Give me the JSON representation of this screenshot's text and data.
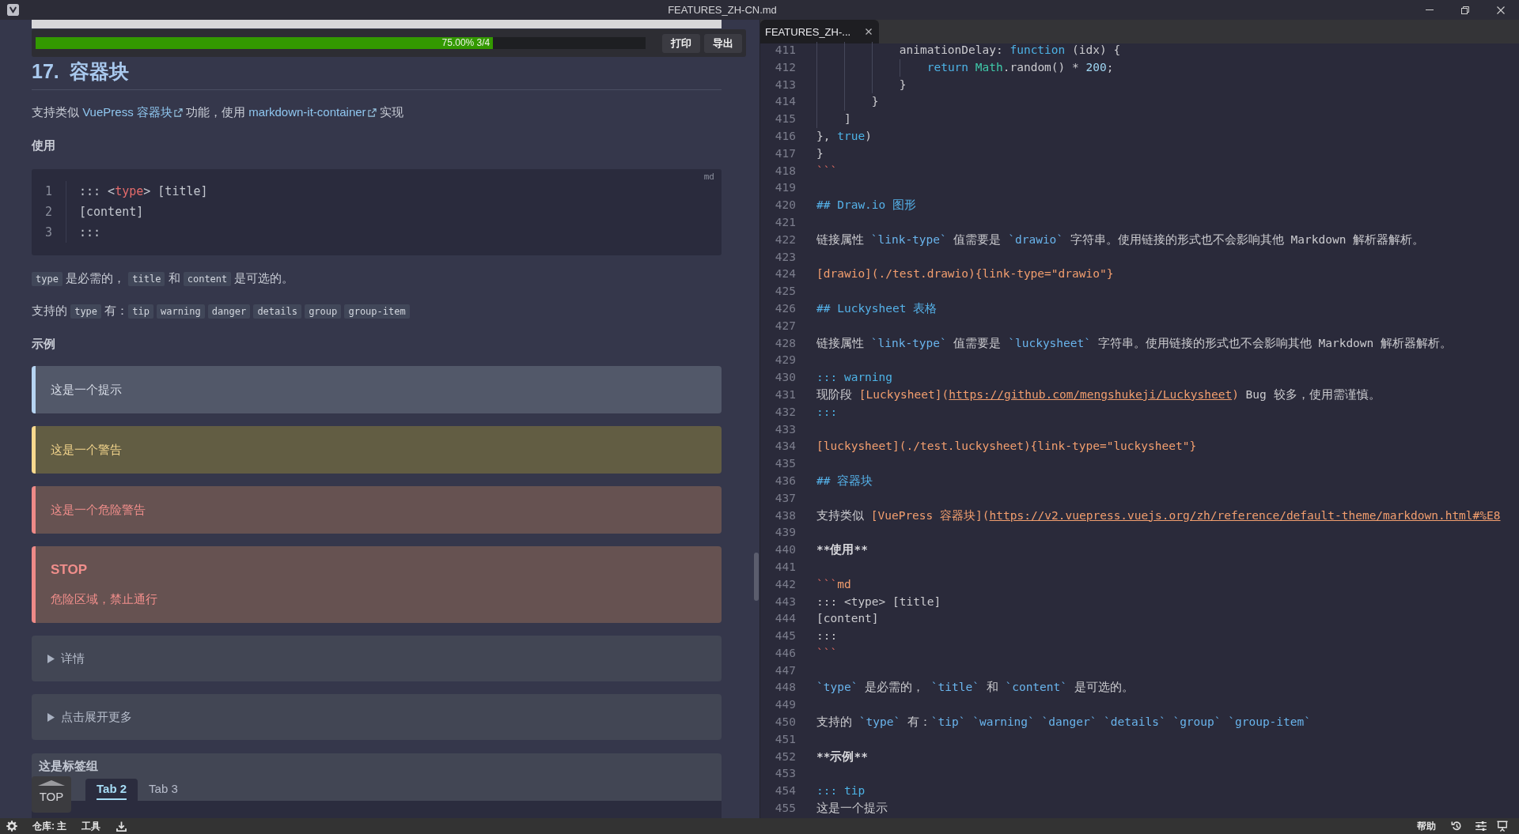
{
  "window": {
    "title": "FEATURES_ZH-CN.md"
  },
  "preview": {
    "progress": {
      "level": 0.75,
      "label": "75.00% 3/4"
    },
    "progress_buttons": [
      "打印",
      "导出"
    ],
    "heading": "17. 容器块",
    "intro": [
      {
        "kind": "text",
        "text": "支持类似 "
      },
      {
        "kind": "link",
        "text": "VuePress 容器块"
      },
      {
        "kind": "text",
        "text": " 功能，使用 "
      },
      {
        "kind": "link",
        "text": "markdown-it-container"
      },
      {
        "kind": "text",
        "text": " 实现"
      }
    ],
    "usage_label": "使用",
    "code_block": {
      "language": "md",
      "lines": [
        {
          "number": "1",
          "segments": [
            {
              "kind": "plain",
              "text": "::: <"
            },
            {
              "kind": "tag",
              "text": "type"
            },
            {
              "kind": "plain",
              "text": "> [title]"
            }
          ]
        },
        {
          "number": "2",
          "segments": [
            {
              "kind": "plain",
              "text": "[content]"
            }
          ]
        },
        {
          "number": "3",
          "segments": [
            {
              "kind": "plain",
              "text": ":::"
            }
          ]
        }
      ]
    },
    "notes": [
      [
        {
          "kind": "code",
          "text": "type"
        },
        {
          "kind": "text",
          "text": " 是必需的， "
        },
        {
          "kind": "code",
          "text": "title"
        },
        {
          "kind": "text",
          "text": " 和 "
        },
        {
          "kind": "code",
          "text": "content"
        },
        {
          "kind": "text",
          "text": " 是可选的。"
        }
      ],
      [
        {
          "kind": "text",
          "text": "支持的 "
        },
        {
          "kind": "code",
          "text": "type"
        },
        {
          "kind": "text",
          "text": " 有："
        },
        {
          "kind": "code",
          "text": "tip"
        },
        {
          "kind": "code",
          "text": "warning"
        },
        {
          "kind": "code",
          "text": "danger"
        },
        {
          "kind": "code",
          "text": "details"
        },
        {
          "kind": "code",
          "text": "group"
        },
        {
          "kind": "code",
          "text": "group-item"
        }
      ]
    ],
    "example_label": "示例",
    "containers": [
      {
        "kind": "tip",
        "text": "这是一个提示"
      },
      {
        "kind": "warning",
        "text": "这是一个警告"
      },
      {
        "kind": "danger",
        "text": "这是一个危险警告"
      },
      {
        "kind": "danger",
        "title": "STOP",
        "text": "危险区域，禁止通行"
      },
      {
        "kind": "details",
        "summary": "详情",
        "expanded": false
      },
      {
        "kind": "details",
        "summary": "点击展开更多",
        "expanded": false
      },
      {
        "kind": "group",
        "title": "这是标签组",
        "tabs": [
          {
            "label": "Tab 2",
            "selected": true
          },
          {
            "label": "Tab 3",
            "selected": false
          }
        ]
      }
    ],
    "back_to_top": "TOP"
  },
  "editor": {
    "tabs": [
      {
        "label": "FEATURES_ZH-...",
        "selected": true
      }
    ],
    "lines": [
      {
        "number": "411",
        "segments": [
          {
            "kind": "plain",
            "text": "            animationDelay: "
          },
          {
            "kind": "keyword",
            "text": "function"
          },
          {
            "kind": "plain",
            "text": " (idx) {"
          }
        ]
      },
      {
        "number": "412",
        "segments": [
          {
            "kind": "keyword",
            "text": "                return"
          },
          {
            "kind": "type",
            "text": " Math"
          },
          {
            "kind": "plain",
            "text": ".random() * "
          },
          {
            "kind": "number",
            "text": "200"
          },
          {
            "kind": "plain",
            "text": ";"
          }
        ]
      },
      {
        "number": "413",
        "segments": [
          {
            "kind": "plain",
            "text": "            }"
          }
        ]
      },
      {
        "number": "414",
        "segments": [
          {
            "kind": "plain",
            "text": "        }"
          }
        ]
      },
      {
        "number": "415",
        "segments": [
          {
            "kind": "plain",
            "text": "    ]"
          }
        ]
      },
      {
        "number": "416",
        "segments": [
          {
            "kind": "plain",
            "text": "}, "
          },
          {
            "kind": "keyword",
            "text": "true"
          },
          {
            "kind": "plain",
            "text": ")"
          }
        ]
      },
      {
        "number": "417",
        "segments": [
          {
            "kind": "plain",
            "text": "}"
          }
        ]
      },
      {
        "number": "418",
        "segments": [
          {
            "kind": "fence",
            "text": "```"
          }
        ]
      },
      {
        "number": "419"
      },
      {
        "number": "420",
        "segments": [
          {
            "kind": "heading",
            "text": "## Draw.io 图形"
          }
        ]
      },
      {
        "number": "421"
      },
      {
        "number": "422",
        "segments": [
          {
            "kind": "plain",
            "text": "链接属性 "
          },
          {
            "kind": "code",
            "text": "`link-type`"
          },
          {
            "kind": "plain",
            "text": " 值需要是 "
          },
          {
            "kind": "code",
            "text": "`drawio`"
          },
          {
            "kind": "plain",
            "text": " 字符串。使用链接的形式也不会影响其他 Markdown 解析器解析。"
          }
        ]
      },
      {
        "number": "423"
      },
      {
        "number": "424",
        "segments": [
          {
            "kind": "link",
            "text": "[drawio](./test.drawio){link-type=\"drawio\"}"
          }
        ]
      },
      {
        "number": "425"
      },
      {
        "number": "426",
        "segments": [
          {
            "kind": "heading",
            "text": "## Luckysheet 表格"
          }
        ]
      },
      {
        "number": "427"
      },
      {
        "number": "428",
        "segments": [
          {
            "kind": "plain",
            "text": "链接属性 "
          },
          {
            "kind": "code",
            "text": "`link-type`"
          },
          {
            "kind": "plain",
            "text": " 值需要是 "
          },
          {
            "kind": "code",
            "text": "`luckysheet`"
          },
          {
            "kind": "plain",
            "text": " 字符串。使用链接的形式也不会影响其他 Markdown 解析器解析。"
          }
        ]
      },
      {
        "number": "429"
      },
      {
        "number": "430",
        "segments": [
          {
            "kind": "container",
            "text": "::: warning"
          }
        ]
      },
      {
        "number": "431",
        "segments": [
          {
            "kind": "plain",
            "text": "现阶段 "
          },
          {
            "kind": "link",
            "text": "[Luckysheet]("
          },
          {
            "kind": "url",
            "text": "https://github.com/mengshukeji/Luckysheet"
          },
          {
            "kind": "link",
            "text": ")"
          },
          {
            "kind": "plain",
            "text": " Bug 较多，使用需谨慎。"
          }
        ]
      },
      {
        "number": "432",
        "segments": [
          {
            "kind": "container",
            "text": ":::"
          }
        ]
      },
      {
        "number": "433"
      },
      {
        "number": "434",
        "segments": [
          {
            "kind": "link",
            "text": "[luckysheet](./test.luckysheet){link-type=\"luckysheet\"}"
          }
        ]
      },
      {
        "number": "435"
      },
      {
        "number": "436",
        "segments": [
          {
            "kind": "heading",
            "text": "## 容器块"
          }
        ]
      },
      {
        "number": "437"
      },
      {
        "number": "438",
        "segments": [
          {
            "kind": "plain",
            "text": "支持类似 "
          },
          {
            "kind": "link",
            "text": "[VuePress 容器块]("
          },
          {
            "kind": "url",
            "text": "https://v2.vuepress.vuejs.org/zh/reference/default-theme/markdown.html#%E8"
          }
        ]
      },
      {
        "number": "439"
      },
      {
        "number": "440",
        "segments": [
          {
            "kind": "bold",
            "text": "**使用**"
          }
        ]
      },
      {
        "number": "441"
      },
      {
        "number": "442",
        "segments": [
          {
            "kind": "fence",
            "text": "```"
          },
          {
            "kind": "lang",
            "text": "md"
          }
        ]
      },
      {
        "number": "443",
        "segments": [
          {
            "kind": "plain",
            "text": "::: <type> [title]"
          }
        ]
      },
      {
        "number": "444",
        "segments": [
          {
            "kind": "plain",
            "text": "[content]"
          }
        ]
      },
      {
        "number": "445",
        "segments": [
          {
            "kind": "plain",
            "text": ":::"
          }
        ]
      },
      {
        "number": "446",
        "segments": [
          {
            "kind": "fence",
            "text": "```"
          }
        ]
      },
      {
        "number": "447"
      },
      {
        "number": "448",
        "segments": [
          {
            "kind": "code",
            "text": "`type`"
          },
          {
            "kind": "plain",
            "text": " 是必需的， "
          },
          {
            "kind": "code",
            "text": "`title`"
          },
          {
            "kind": "plain",
            "text": " 和 "
          },
          {
            "kind": "code",
            "text": "`content`"
          },
          {
            "kind": "plain",
            "text": " 是可选的。"
          }
        ]
      },
      {
        "number": "449"
      },
      {
        "number": "450",
        "segments": [
          {
            "kind": "plain",
            "text": "支持的 "
          },
          {
            "kind": "code",
            "text": "`type`"
          },
          {
            "kind": "plain",
            "text": " 有："
          },
          {
            "kind": "code",
            "text": "`tip` `warning` `danger` `details` `group` `group-item`"
          }
        ]
      },
      {
        "number": "451"
      },
      {
        "number": "452",
        "segments": [
          {
            "kind": "bold",
            "text": "**示例**"
          }
        ]
      },
      {
        "number": "453"
      },
      {
        "number": "454",
        "segments": [
          {
            "kind": "container",
            "text": "::: tip"
          }
        ]
      },
      {
        "number": "455",
        "segments": [
          {
            "kind": "plain",
            "text": "这是一个提示"
          }
        ]
      }
    ]
  },
  "status_bar": {
    "left": [
      "仓库: 主",
      "工具"
    ],
    "right": [
      "帮助"
    ]
  }
}
